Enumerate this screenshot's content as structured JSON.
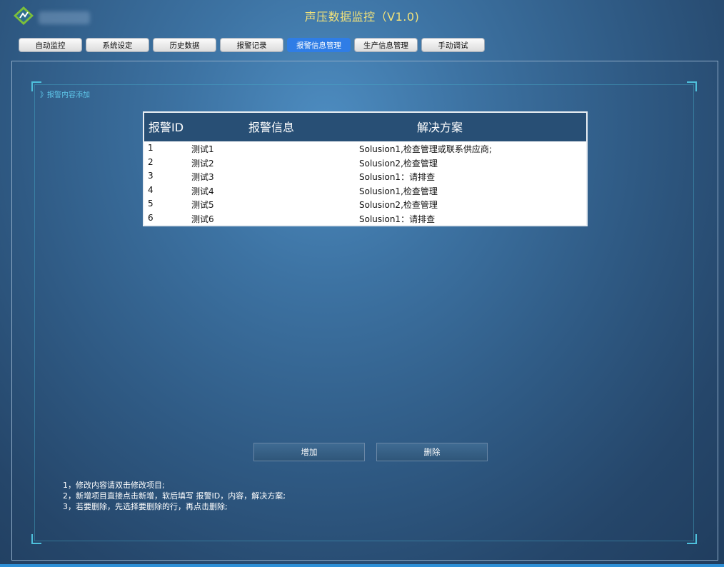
{
  "app": {
    "title": "声压数据监控（V1.0)"
  },
  "tabs": [
    "自动监控",
    "系统设定",
    "历史数据",
    "报警记录",
    "报警信息管理",
    "生产信息管理",
    "手动调试"
  ],
  "active_tab": "报警信息管理",
  "section": {
    "label": "》报警内容添加"
  },
  "table": {
    "columns": [
      "报警ID",
      "报警信息",
      "解决方案"
    ],
    "rows": [
      {
        "id": "1",
        "info": "测试1",
        "solution": "Solusion1,检查管理或联系供应商;"
      },
      {
        "id": "2",
        "info": "测试2",
        "solution": "Solusion2,检查管理"
      },
      {
        "id": "3",
        "info": "测试3",
        "solution": "Solusion1：请排查"
      },
      {
        "id": "4",
        "info": "测试4",
        "solution": "Solusion1,检查管理"
      },
      {
        "id": "5",
        "info": "测试5",
        "solution": "Solusion2,检查管理"
      },
      {
        "id": "6",
        "info": "测试6",
        "solution": "Solusion1：请排查"
      }
    ]
  },
  "buttons": {
    "add": "增加",
    "delete": "删除"
  },
  "notes": [
    "1，修改内容请双击修改项目;",
    "2，新增项目直接点击新增，软后填写 报警ID，内容，解决方案;",
    "3，若要删除，先选择要删除的行，再点击删除;"
  ],
  "colors": {
    "active_tab": "#2f7de6",
    "title": "#f2e27a",
    "table_header": "#284f75"
  }
}
